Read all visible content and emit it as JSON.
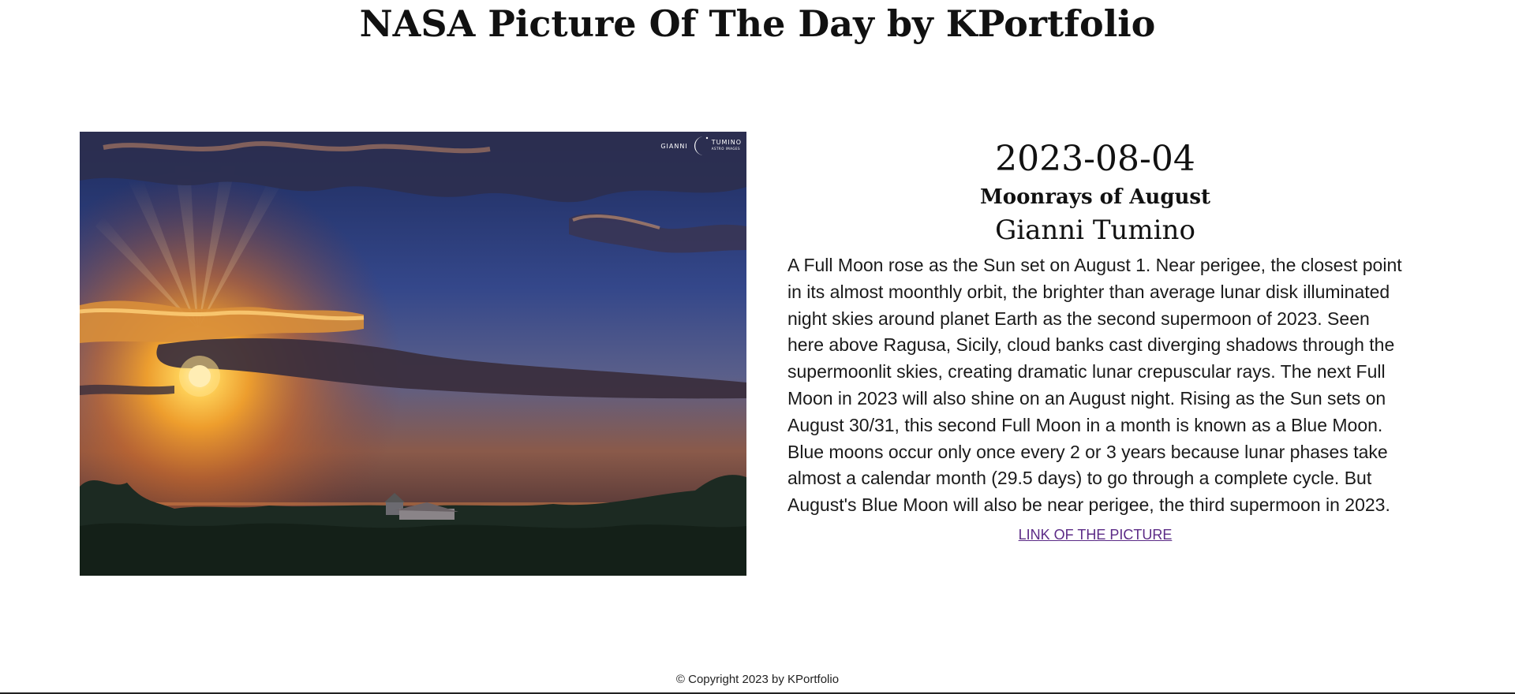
{
  "header": {
    "title": "NASA Picture Of The Day by KPortfolio"
  },
  "picture": {
    "alt": "Moonrays of August",
    "watermark_left": "GIANNI",
    "watermark_right": "TUMINO",
    "watermark_sub": "ASTRO IMAGES",
    "watermark_icon": "crescent-moon-icon"
  },
  "info": {
    "date": "2023-08-04",
    "title": "Moonrays of August",
    "author": "Gianni Tumino",
    "explanation": "A Full Moon rose as the Sun set on August 1. Near perigee, the closest point in its almost moonthly orbit, the brighter than average lunar disk illuminated night skies around planet Earth as the second supermoon of 2023. Seen here above Ragusa, Sicily, cloud banks cast diverging shadows through the supermoonlit skies, creating dramatic lunar crepuscular rays. The next Full Moon in 2023 will also shine on an August night. Rising as the Sun sets on August 30/31, this second Full Moon in a month is known as a Blue Moon. Blue moons occur only once every 2 or 3 years because lunar phases take almost a calendar month (29.5 days) to go through a complete cycle. But August's Blue Moon will also be near perigee, the third supermoon in 2023.",
    "link_label": "LINK OF THE PICTURE"
  },
  "footer": {
    "copyright": "© Copyright 2023 by KPortfolio"
  },
  "colors": {
    "link": "#5b2a86",
    "text": "#111111",
    "background": "#ffffff"
  }
}
